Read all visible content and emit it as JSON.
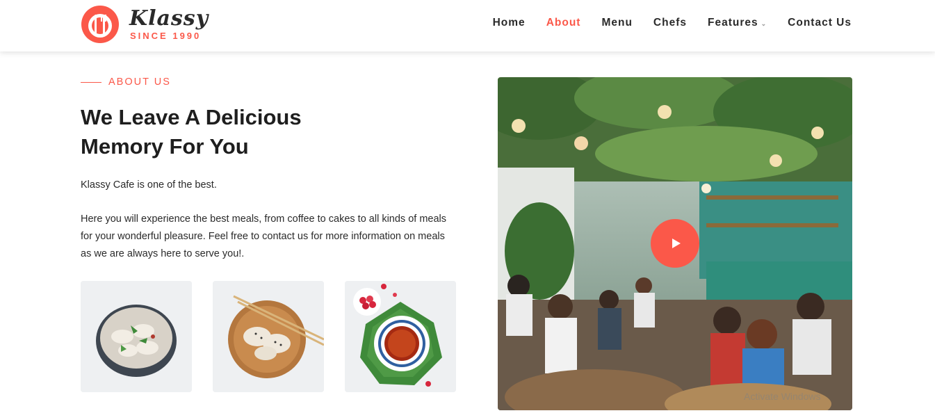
{
  "brand": {
    "name": "Klassy",
    "tagline": "SINCE 1990",
    "accent": "#fb5849"
  },
  "nav": {
    "items": [
      {
        "label": "Home"
      },
      {
        "label": "About"
      },
      {
        "label": "Menu"
      },
      {
        "label": "Chefs"
      },
      {
        "label": "Features"
      },
      {
        "label": "Contact Us"
      }
    ],
    "active": "About"
  },
  "about": {
    "section_label": "ABOUT US",
    "title_line1": "We Leave A Delicious",
    "title_line2": "Memory For You",
    "paragraph1": "Klassy Cafe is one of the best.",
    "paragraph2": "Here you will experience the best meals, from coffee to cakes to all kinds of meals for your wonderful pleasure. Feel free to contact us for more information on meals as we are always here to serve you!."
  },
  "thumbnails": [
    {
      "icon": "dumplings-bowl-image"
    },
    {
      "icon": "dumplings-chopsticks-image"
    },
    {
      "icon": "tea-cup-image"
    }
  ],
  "video": {
    "icon": "play-icon"
  },
  "watermark": "Activate Windows"
}
